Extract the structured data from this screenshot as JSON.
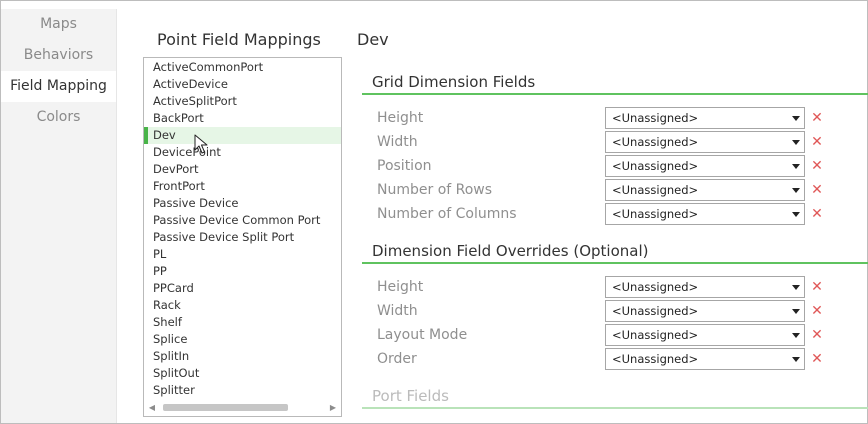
{
  "nav": {
    "items": [
      {
        "label": "Maps"
      },
      {
        "label": "Behaviors"
      },
      {
        "label": "Field Mapping"
      },
      {
        "label": "Colors"
      }
    ]
  },
  "point_list": {
    "title": "Point Field Mappings",
    "selected": "Dev",
    "items": [
      "ActiveCommonPort",
      "ActiveDevice",
      "ActiveSplitPort",
      "BackPort",
      "Dev",
      "DevicePoint",
      "DevPort",
      "FrontPort",
      "Passive Device",
      "Passive Device Common Port",
      "Passive Device Split Port",
      "PL",
      "PP",
      "PPCard",
      "Rack",
      "Shelf",
      "Splice",
      "SplitIn",
      "SplitOut",
      "Splitter"
    ]
  },
  "detail": {
    "title": "Dev",
    "sections": [
      {
        "title": "Grid Dimension Fields",
        "fields": [
          {
            "label": "Height",
            "value": "<Unassigned>"
          },
          {
            "label": "Width",
            "value": "<Unassigned>"
          },
          {
            "label": "Position",
            "value": "<Unassigned>"
          },
          {
            "label": "Number of Rows",
            "value": "<Unassigned>"
          },
          {
            "label": "Number of Columns",
            "value": "<Unassigned>"
          }
        ]
      },
      {
        "title": "Dimension Field Overrides (Optional)",
        "fields": [
          {
            "label": "Height",
            "value": "<Unassigned>"
          },
          {
            "label": "Width",
            "value": "<Unassigned>"
          },
          {
            "label": "Layout Mode",
            "value": "<Unassigned>"
          },
          {
            "label": "Order",
            "value": "<Unassigned>"
          }
        ]
      },
      {
        "title": "Port Fields",
        "fields": []
      }
    ],
    "clear_glyph": "✕"
  },
  "colors": {
    "accent": "#5fc35f",
    "selected_bg": "#e6f6e6",
    "clear_red": "#e05757"
  },
  "icons": {
    "cursor": "mouse-pointer-icon",
    "clear": "close-icon",
    "dropdown": "caret-down-icon",
    "scroll_left": "arrow-left-icon",
    "scroll_right": "arrow-right-icon"
  }
}
